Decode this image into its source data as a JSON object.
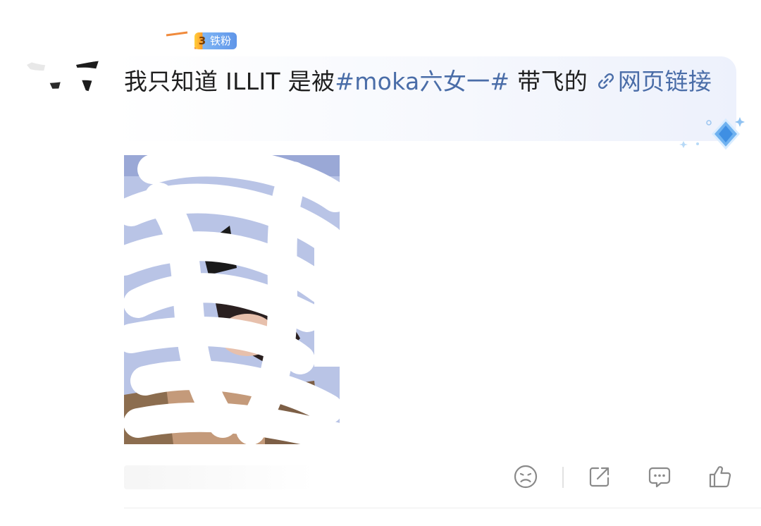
{
  "user": {
    "level_badge": {
      "number": "3",
      "text": "铁粉"
    }
  },
  "comment": {
    "text_before": "我只知道 ILLIT 是被",
    "topic": "#moka六女一#",
    "text_after": " 带飞的 ",
    "link_label": "网页链接"
  },
  "actions": [
    {
      "name": "reaction",
      "icon": "sad-face-icon"
    },
    {
      "name": "share",
      "icon": "share-icon"
    },
    {
      "name": "comment",
      "icon": "comment-icon"
    },
    {
      "name": "like",
      "icon": "thumbs-up-icon"
    }
  ],
  "colors": {
    "topic_link": "#4a6da8",
    "icon_gray": "#8a8a8a",
    "bubble_tint": "#edf1fc"
  }
}
